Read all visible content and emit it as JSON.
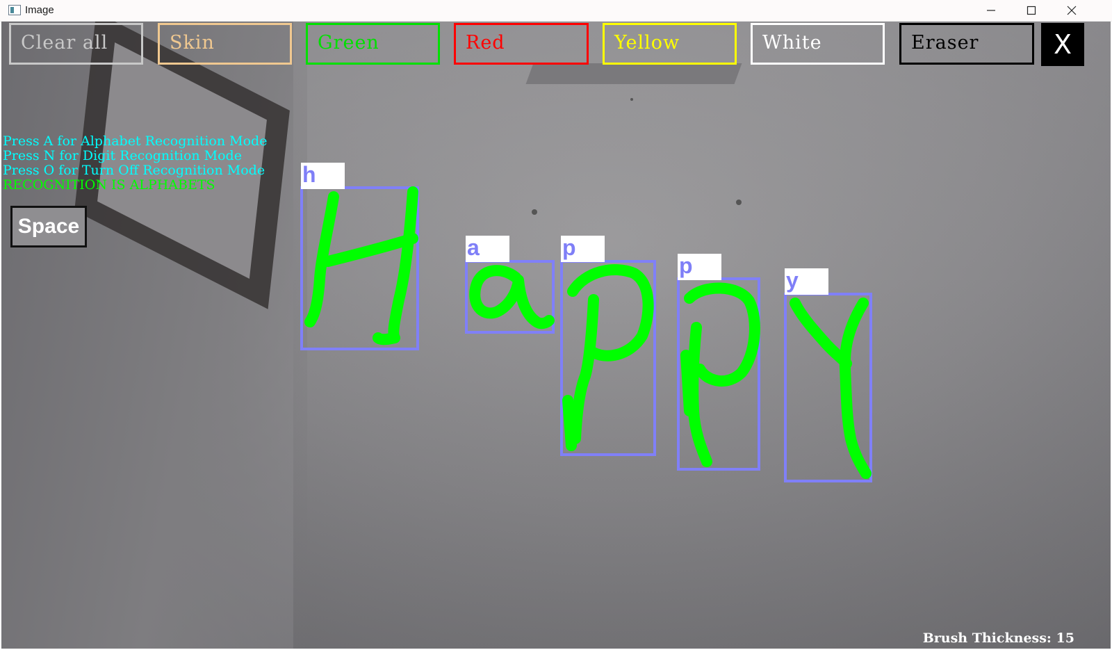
{
  "window": {
    "title": "Image"
  },
  "toolbar": {
    "buttons": [
      {
        "label": "Clear all",
        "color": "#c8c8c8"
      },
      {
        "label": "Skin",
        "color": "#f0c890"
      },
      {
        "label": "Green",
        "color": "#00e000"
      },
      {
        "label": "Red",
        "color": "#ff0000"
      },
      {
        "label": "Yellow",
        "color": "#ffff00"
      },
      {
        "label": "White",
        "color": "#ffffff"
      },
      {
        "label": "Eraser",
        "color": "#000000"
      }
    ],
    "close_label": "X"
  },
  "info": {
    "line1": "Press A for Alphabet Recognition Mode",
    "line2": "Press N for Digit Recognition Mode",
    "line3": "Press O for Turn Off Recognition Mode",
    "status": "RECOGNITION IS ALPHABETS",
    "info_color": "#00ffff",
    "status_color": "#00ff00"
  },
  "space_button": {
    "label": "Space"
  },
  "recognized": [
    {
      "letter": "h"
    },
    {
      "letter": "a"
    },
    {
      "letter": "p"
    },
    {
      "letter": "p"
    },
    {
      "letter": "y"
    }
  ],
  "brush": {
    "text": "Brush Thickness: 15"
  },
  "colors": {
    "stroke": "#00ff00",
    "bbox": "#8080f8"
  }
}
